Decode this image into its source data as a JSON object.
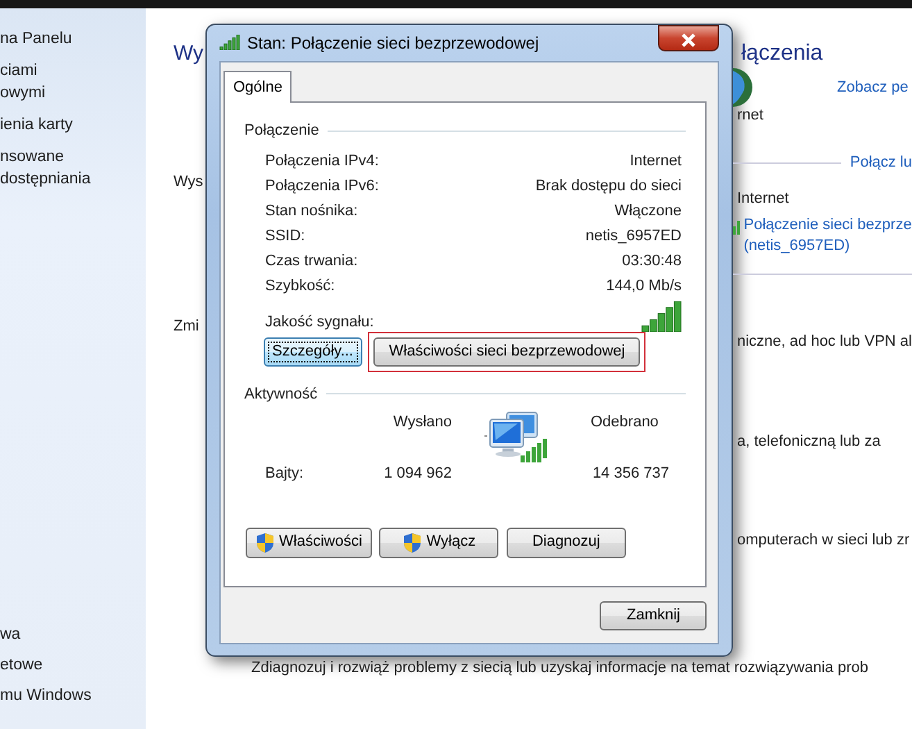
{
  "sidebar": {
    "top_items": [
      {
        "lines": [
          "na Panelu"
        ]
      },
      {
        "lines": [
          "ciami",
          "owymi"
        ]
      },
      {
        "lines": [
          "ienia karty"
        ]
      },
      {
        "lines": [
          "nsowane",
          "dostępniania"
        ]
      }
    ],
    "bottom_items": [
      "wa",
      "etowe",
      "mu Windows"
    ]
  },
  "left_strip": [
    {
      "kind": "heading",
      "text": "Wy"
    },
    {
      "kind": "text",
      "text": "Wys"
    },
    {
      "kind": "text",
      "text": "Zmi"
    }
  ],
  "right_strip": [
    {
      "kind": "heading",
      "text": "łączenia"
    },
    {
      "kind": "globe"
    },
    {
      "kind": "link",
      "text": "Zobacz pe"
    },
    {
      "kind": "text",
      "text": "rnet"
    },
    {
      "kind": "rule-link",
      "text": "Połącz lu"
    },
    {
      "kind": "text",
      "text": "Internet"
    },
    {
      "kind": "network-link",
      "lines": [
        "Połączenie sieci bezprze",
        "(netis_6957ED)"
      ]
    },
    {
      "kind": "rule"
    },
    {
      "kind": "text",
      "text": "niczne, ad hoc lub VPN al"
    },
    {
      "kind": "text",
      "text": "a, telefoniczną lub za"
    },
    {
      "kind": "text",
      "text": "omputerach w sieci lub zr"
    }
  ],
  "bottom_text": "Zdiagnozuj i rozwiąż problemy z siecią lub uzyskaj informacje na temat rozwiązywania prob",
  "dialog": {
    "title": "Stan: Połączenie sieci bezprzewodowej",
    "tabs": [
      {
        "label": "Ogólne",
        "selected": true
      }
    ],
    "connection": {
      "label": "Połączenie",
      "rows": [
        {
          "label": "Połączenia IPv4:",
          "value": "Internet"
        },
        {
          "label": "Połączenia IPv6:",
          "value": "Brak dostępu do sieci"
        },
        {
          "label": "Stan nośnika:",
          "value": "Włączone"
        },
        {
          "label": "SSID:",
          "value": "netis_6957ED"
        },
        {
          "label": "Czas trwania:",
          "value": "03:30:48"
        },
        {
          "label": "Szybkość:",
          "value": "144,0 Mb/s"
        }
      ],
      "signal_label": "Jakość sygnału:",
      "buttons": [
        {
          "label": "Szczegóły...",
          "focused": true,
          "highlighted": false
        },
        {
          "label": "Właściwości sieci bezprzewodowej",
          "focused": false,
          "highlighted": true
        }
      ]
    },
    "activity": {
      "label": "Aktywność",
      "sent_label": "Wysłano",
      "received_label": "Odebrano",
      "bytes_label": "Bajty:",
      "sent": "1 094 962",
      "received": "14 356 737",
      "buttons": [
        {
          "label": "Właściwości",
          "shield": true
        },
        {
          "label": "Wyłącz",
          "shield": true
        },
        {
          "label": "Diagnozuj",
          "shield": false
        }
      ]
    },
    "close_button": "Zamknij"
  }
}
